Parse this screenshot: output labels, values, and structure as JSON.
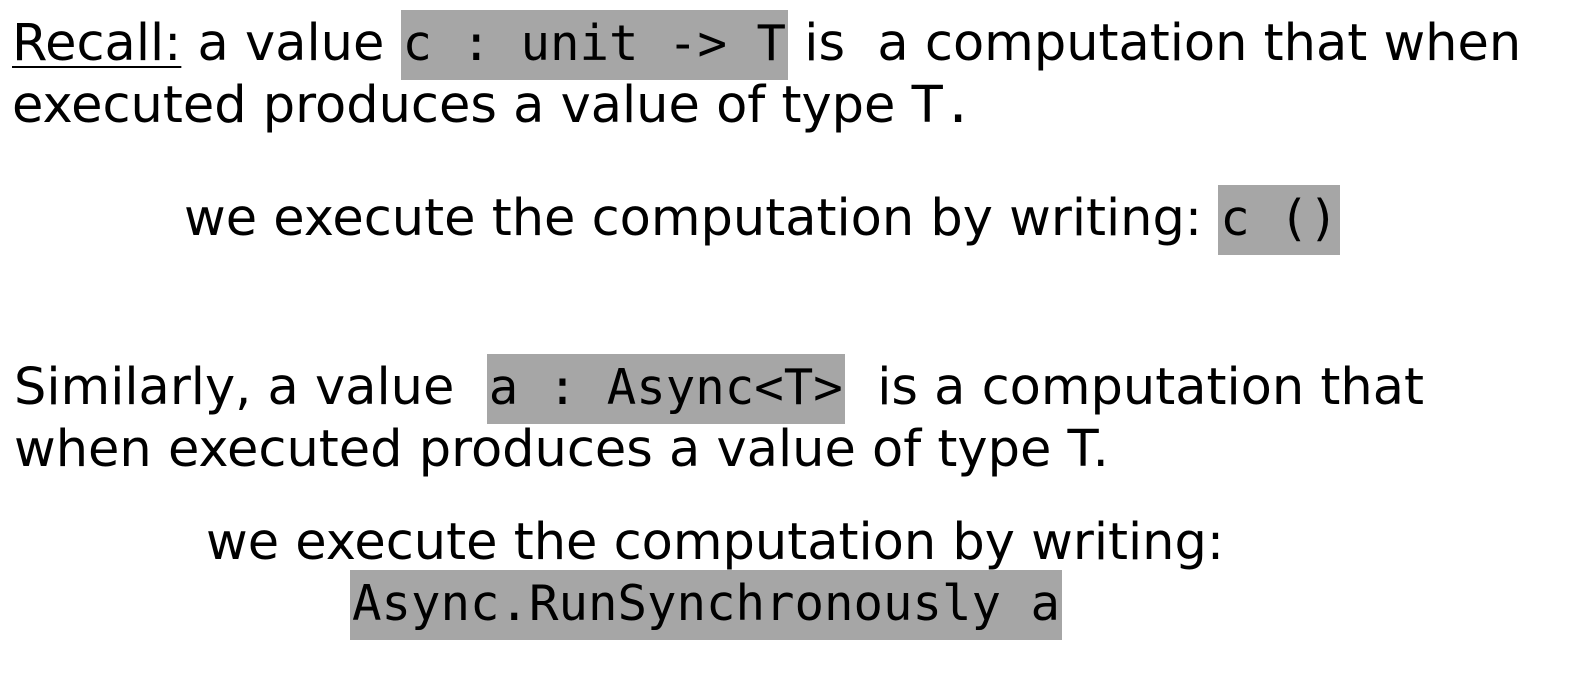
{
  "colors": {
    "code_highlight": "#a6a6a6",
    "text": "#000000",
    "background": "#ffffff"
  },
  "recall": {
    "label": "Recall:",
    "text1": " a value ",
    "code": "c : unit -> T",
    "text2": " is  a computation that when",
    "line2": "executed produces a value of type T",
    "line2_period": "."
  },
  "exec1": {
    "text": "we execute the computation by writing: ",
    "code": "c ()"
  },
  "similar": {
    "text1": "Similarly, a value  ",
    "code": "a : Async<T>",
    "text2": "  is a computation that",
    "line2": "when executed produces a value of type T."
  },
  "exec2": {
    "text": "we execute the computation by writing:",
    "code": "Async.RunSynchronously a"
  }
}
